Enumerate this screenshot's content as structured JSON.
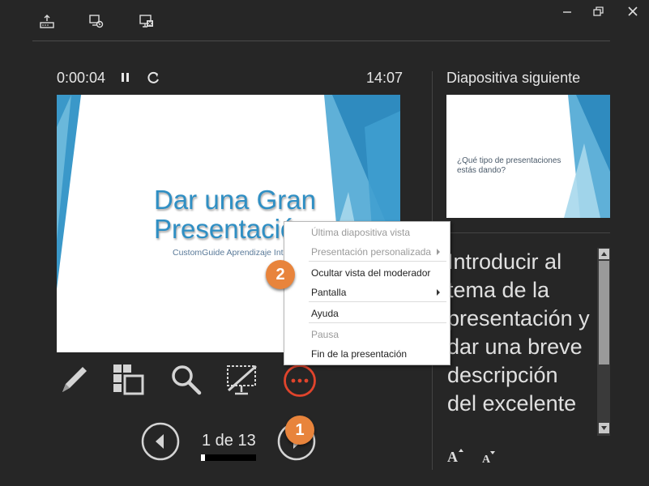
{
  "colors": {
    "background": "#262626",
    "accent": "#e0442c",
    "callout": "#e8843c",
    "slide_blue": "#2f8fc4"
  },
  "toolbar": {
    "icons": [
      "taskbar-icon",
      "display-settings-icon",
      "end-show-icon"
    ]
  },
  "window": {
    "minimize": "–",
    "restore": "❐",
    "close": "✕"
  },
  "timer": {
    "elapsed": "0:00:04",
    "clock": "14:07"
  },
  "current_slide": {
    "title": "Dar una Gran Presentación",
    "subtitle": "CustomGuide Aprendizaje Interactivo"
  },
  "next_slide": {
    "label": "Diapositiva siguiente",
    "text": "¿Qué tipo de presentaciones estás dando?"
  },
  "notes": {
    "text": "Introducir al tema de la presentación y dar una breve descripción del excelente"
  },
  "context_menu": {
    "items": [
      {
        "label": "Última diapositiva vista",
        "disabled": true
      },
      {
        "label": "Presentación personalizada",
        "disabled": true,
        "submenu": true
      },
      {
        "label": "Ocultar vista del moderador",
        "disabled": false
      },
      {
        "label": "Pantalla",
        "disabled": false,
        "submenu": true
      },
      {
        "label": "Ayuda",
        "disabled": false
      },
      {
        "label": "Pausa",
        "disabled": true
      },
      {
        "label": "Fin de la presentación",
        "disabled": false
      }
    ]
  },
  "navigation": {
    "counter": "1 de 13",
    "current": 1,
    "total": 13
  },
  "callouts": {
    "first": "1",
    "second": "2"
  }
}
